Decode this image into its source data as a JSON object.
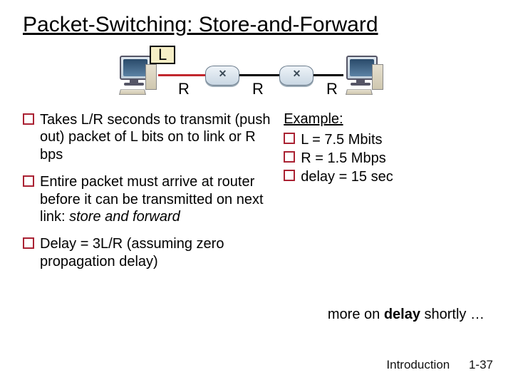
{
  "title": "Packet-Switching: Store-and-Forward",
  "diagram": {
    "L_label": "L",
    "R1": "R",
    "R2": "R",
    "R3": "R"
  },
  "left_bullets": {
    "b1a": "Takes L/R seconds to transmit (push out) packet of L bits on to link or R bps",
    "b2a": "Entire packet must  arrive at router before it can be transmitted on next link: ",
    "b2b": "store and forward",
    "b3": "Delay = 3L/R (assuming zero propagation delay)"
  },
  "example": {
    "head": "Example:",
    "l1": "L = 7.5 Mbits",
    "l2": "R = 1.5 Mbps",
    "l3": "delay = 15 sec"
  },
  "more_a": "more on ",
  "more_b": "delay",
  "more_c": " shortly …",
  "footer": {
    "section": "Introduction",
    "page": "1-37"
  }
}
